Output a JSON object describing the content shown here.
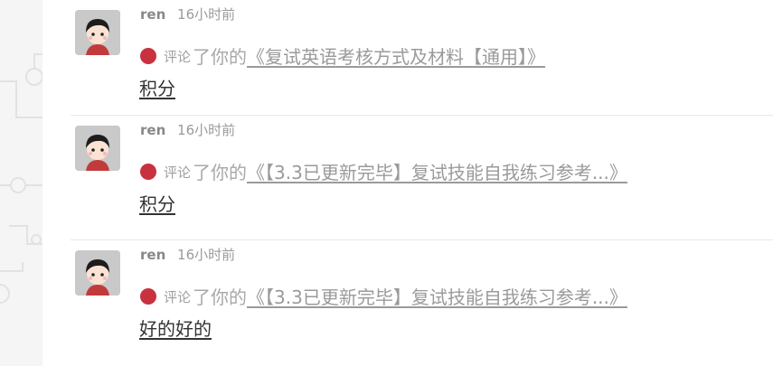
{
  "colors": {
    "dot": "#c8323f",
    "meta_text": "#9a9a9a",
    "link_text": "#9a9a9a",
    "body_text": "#333333",
    "divider": "#e9e9e9",
    "side_panel": "#f5f5f5"
  },
  "notifications": [
    {
      "user": "ren",
      "time": "16小时前",
      "action_small": "评论",
      "action_big": "了你的",
      "title": "《复试英语考核方式及材料【通用】》",
      "body": "积分"
    },
    {
      "user": "ren",
      "time": "16小时前",
      "action_small": "评论",
      "action_big": "了你的",
      "title": "《【3.3已更新完毕】复试技能自我练习参考...》",
      "body": "积分"
    },
    {
      "user": "ren",
      "time": "16小时前",
      "action_small": "评论",
      "action_big": "了你的",
      "title": "《【3.3已更新完毕】复试技能自我练习参考...》",
      "body": "好的好的"
    }
  ]
}
